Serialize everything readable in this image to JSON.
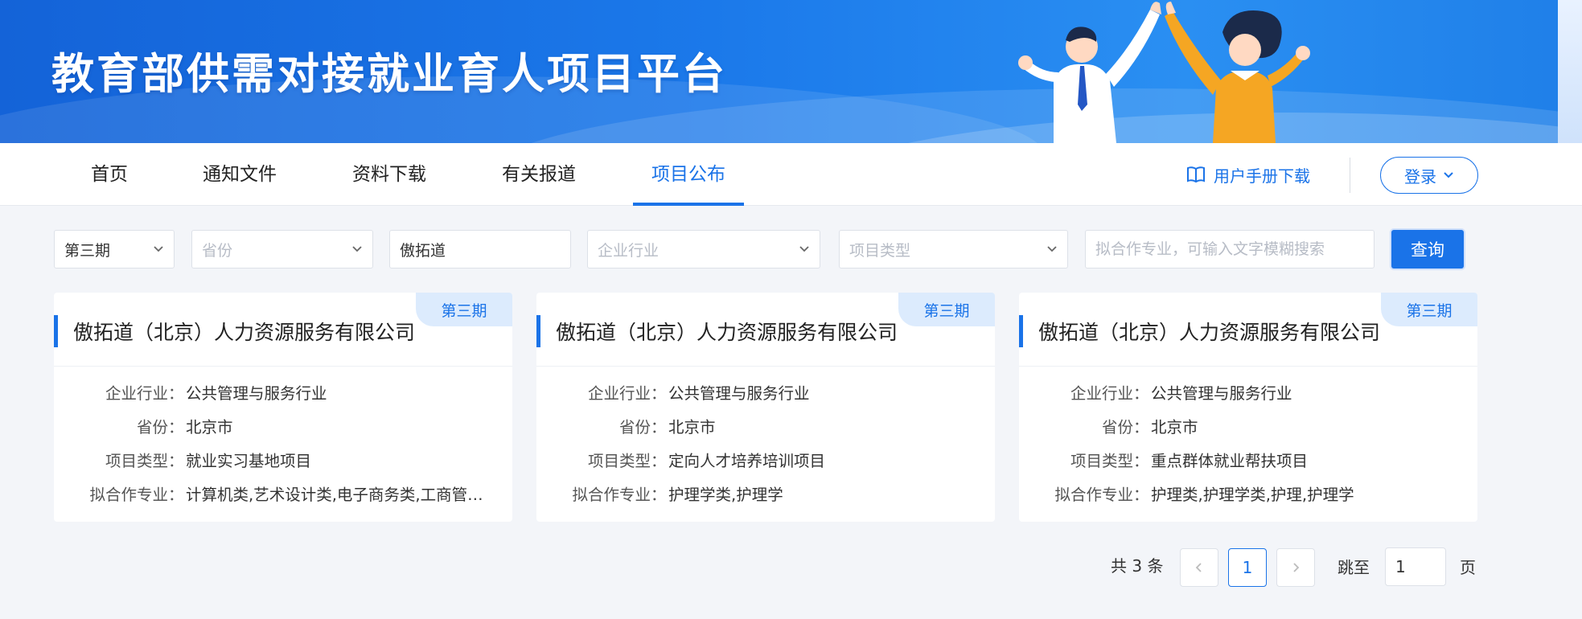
{
  "banner": {
    "title": "教育部供需对接就业育人项目平台"
  },
  "nav": {
    "items": [
      {
        "label": "首页"
      },
      {
        "label": "通知文件"
      },
      {
        "label": "资料下载"
      },
      {
        "label": "有关报道"
      },
      {
        "label": "项目公布"
      }
    ],
    "active_index": 4,
    "manual_label": "用户手册下载",
    "manual_icon": "book-icon",
    "login_label": "登录",
    "accent_color": "#1a73e8"
  },
  "filters": {
    "period": {
      "value": "第三期"
    },
    "province": {
      "placeholder": "省份"
    },
    "company": {
      "value": "傲拓道"
    },
    "industry": {
      "placeholder": "企业行业"
    },
    "project_type": {
      "placeholder": "项目类型"
    },
    "major": {
      "placeholder": "拟合作专业，可输入文字模糊搜索"
    },
    "query_label": "查询"
  },
  "field_labels": {
    "industry": "企业行业",
    "province": "省份",
    "project_type": "项目类型",
    "major": "拟合作专业",
    "colon": "："
  },
  "cards": [
    {
      "tag": "第三期",
      "title": "傲拓道（北京）人力资源服务有限公司",
      "industry": "公共管理与服务行业",
      "province": "北京市",
      "project_type": "就业实习基地项目",
      "major": "计算机类,艺术设计类,电子商务类,工商管理类"
    },
    {
      "tag": "第三期",
      "title": "傲拓道（北京）人力资源服务有限公司",
      "industry": "公共管理与服务行业",
      "province": "北京市",
      "project_type": "定向人才培养培训项目",
      "major": "护理学类,护理学"
    },
    {
      "tag": "第三期",
      "title": "傲拓道（北京）人力资源服务有限公司",
      "industry": "公共管理与服务行业",
      "province": "北京市",
      "project_type": "重点群体就业帮扶项目",
      "major": "护理类,护理学类,护理,护理学"
    }
  ],
  "pagination": {
    "total_label": "共 3 条",
    "current_page": "1",
    "jump_label": "跳至",
    "jump_value": "1",
    "jump_suffix": "页"
  }
}
